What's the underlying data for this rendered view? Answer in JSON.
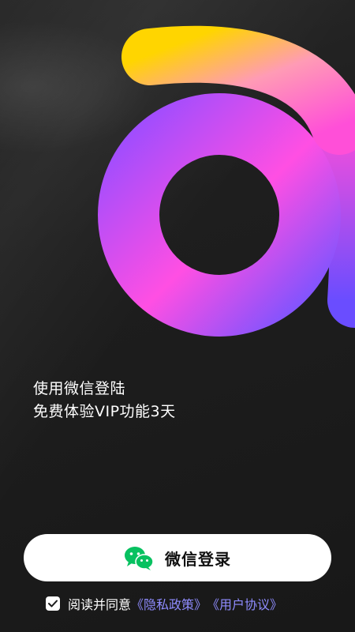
{
  "colors": {
    "background": "#1c1c1c",
    "logo_gradient_top": [
      "#ffd500",
      "#ff8fb0",
      "#ff4fd8"
    ],
    "logo_gradient_loop": [
      "#a24bff",
      "#ff4fe3",
      "#6a4dff"
    ],
    "button_bg": "#ffffff",
    "wechat_green": "#07c160",
    "link_color": "#8f8cff"
  },
  "hero": {
    "icon": "logo-a-swirl-icon"
  },
  "tagline": {
    "line1": "使用微信登陆",
    "line2": "免费体验VIP功能3天"
  },
  "login_button": {
    "label": "微信登录",
    "icon": "wechat-icon"
  },
  "agreement": {
    "checked": true,
    "text": "阅读并同意",
    "privacy_link": "《隐私政策》",
    "user_agreement_link": "《用户协议》"
  }
}
